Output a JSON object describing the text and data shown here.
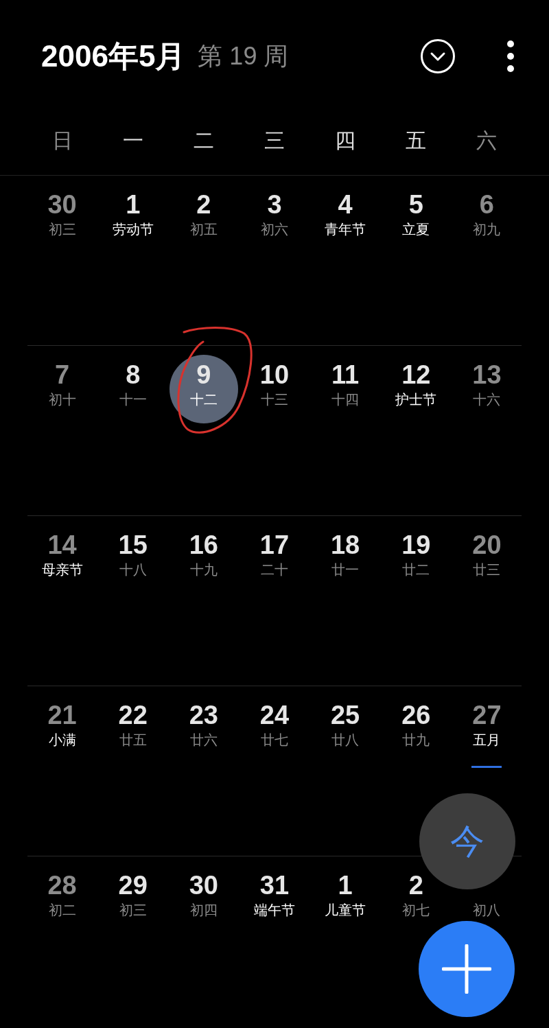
{
  "header": {
    "title": "2006年5月",
    "week": "第 19 周"
  },
  "weekdays": [
    {
      "label": "日",
      "weekend": true
    },
    {
      "label": "一",
      "weekend": false
    },
    {
      "label": "二",
      "weekend": false
    },
    {
      "label": "三",
      "weekend": false
    },
    {
      "label": "四",
      "weekend": false
    },
    {
      "label": "五",
      "weekend": false
    },
    {
      "label": "六",
      "weekend": true
    }
  ],
  "weeks": [
    [
      {
        "day": "30",
        "lunar": "初三",
        "weekend": true,
        "festival": false,
        "selected": false,
        "marked": false
      },
      {
        "day": "1",
        "lunar": "劳动节",
        "weekend": false,
        "festival": true,
        "selected": false,
        "marked": false
      },
      {
        "day": "2",
        "lunar": "初五",
        "weekend": false,
        "festival": false,
        "selected": false,
        "marked": false
      },
      {
        "day": "3",
        "lunar": "初六",
        "weekend": false,
        "festival": false,
        "selected": false,
        "marked": false
      },
      {
        "day": "4",
        "lunar": "青年节",
        "weekend": false,
        "festival": true,
        "selected": false,
        "marked": false
      },
      {
        "day": "5",
        "lunar": "立夏",
        "weekend": false,
        "festival": true,
        "selected": false,
        "marked": false
      },
      {
        "day": "6",
        "lunar": "初九",
        "weekend": true,
        "festival": false,
        "selected": false,
        "marked": false
      }
    ],
    [
      {
        "day": "7",
        "lunar": "初十",
        "weekend": true,
        "festival": false,
        "selected": false,
        "marked": false
      },
      {
        "day": "8",
        "lunar": "十一",
        "weekend": false,
        "festival": false,
        "selected": false,
        "marked": false
      },
      {
        "day": "9",
        "lunar": "十二",
        "weekend": false,
        "festival": false,
        "selected": true,
        "marked": false
      },
      {
        "day": "10",
        "lunar": "十三",
        "weekend": false,
        "festival": false,
        "selected": false,
        "marked": false
      },
      {
        "day": "11",
        "lunar": "十四",
        "weekend": false,
        "festival": false,
        "selected": false,
        "marked": false
      },
      {
        "day": "12",
        "lunar": "护士节",
        "weekend": false,
        "festival": true,
        "selected": false,
        "marked": false
      },
      {
        "day": "13",
        "lunar": "十六",
        "weekend": true,
        "festival": false,
        "selected": false,
        "marked": false
      }
    ],
    [
      {
        "day": "14",
        "lunar": "母亲节",
        "weekend": true,
        "festival": true,
        "selected": false,
        "marked": false
      },
      {
        "day": "15",
        "lunar": "十八",
        "weekend": false,
        "festival": false,
        "selected": false,
        "marked": false
      },
      {
        "day": "16",
        "lunar": "十九",
        "weekend": false,
        "festival": false,
        "selected": false,
        "marked": false
      },
      {
        "day": "17",
        "lunar": "二十",
        "weekend": false,
        "festival": false,
        "selected": false,
        "marked": false
      },
      {
        "day": "18",
        "lunar": "廿一",
        "weekend": false,
        "festival": false,
        "selected": false,
        "marked": false
      },
      {
        "day": "19",
        "lunar": "廿二",
        "weekend": false,
        "festival": false,
        "selected": false,
        "marked": false
      },
      {
        "day": "20",
        "lunar": "廿三",
        "weekend": true,
        "festival": false,
        "selected": false,
        "marked": false
      }
    ],
    [
      {
        "day": "21",
        "lunar": "小满",
        "weekend": true,
        "festival": true,
        "selected": false,
        "marked": false
      },
      {
        "day": "22",
        "lunar": "廿五",
        "weekend": false,
        "festival": false,
        "selected": false,
        "marked": false
      },
      {
        "day": "23",
        "lunar": "廿六",
        "weekend": false,
        "festival": false,
        "selected": false,
        "marked": false
      },
      {
        "day": "24",
        "lunar": "廿七",
        "weekend": false,
        "festival": false,
        "selected": false,
        "marked": false
      },
      {
        "day": "25",
        "lunar": "廿八",
        "weekend": false,
        "festival": false,
        "selected": false,
        "marked": false
      },
      {
        "day": "26",
        "lunar": "廿九",
        "weekend": false,
        "festival": false,
        "selected": false,
        "marked": false
      },
      {
        "day": "27",
        "lunar": "五月",
        "weekend": true,
        "festival": true,
        "selected": false,
        "marked": true
      }
    ],
    [
      {
        "day": "28",
        "lunar": "初二",
        "weekend": true,
        "festival": false,
        "selected": false,
        "marked": false
      },
      {
        "day": "29",
        "lunar": "初三",
        "weekend": false,
        "festival": false,
        "selected": false,
        "marked": false
      },
      {
        "day": "30",
        "lunar": "初四",
        "weekend": false,
        "festival": false,
        "selected": false,
        "marked": false
      },
      {
        "day": "31",
        "lunar": "端午节",
        "weekend": false,
        "festival": true,
        "selected": false,
        "marked": false
      },
      {
        "day": "1",
        "lunar": "儿童节",
        "weekend": false,
        "festival": true,
        "selected": false,
        "marked": false
      },
      {
        "day": "2",
        "lunar": "初七",
        "weekend": false,
        "festival": false,
        "selected": false,
        "marked": false
      },
      {
        "lunar": "初八",
        "weekend": true,
        "festival": false,
        "selected": false,
        "marked": false
      }
    ]
  ],
  "today_button": {
    "label": "今"
  }
}
